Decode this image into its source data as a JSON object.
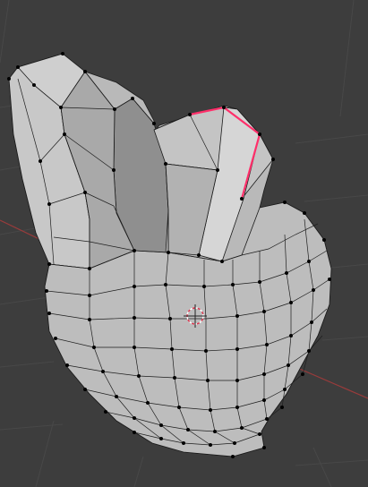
{
  "viewport": {
    "kind": "3d-viewport",
    "mode": "edit-mode",
    "background": "#3d3d3d"
  },
  "colors": {
    "grid": "#4a4a4a",
    "x_axis": "#9a3b3b",
    "mesh_light": "#c9c9c9",
    "mesh_mid": "#b5b5b5",
    "mesh_shadow": "#8f8f8f",
    "wire": "#1b1b1b",
    "vertex": "#000000",
    "selected_edge": "#ff2f6a",
    "cursor_red": "#e0364f",
    "cursor_white": "#ffffff"
  },
  "icons": {
    "cursor": "3d-cursor-icon"
  }
}
